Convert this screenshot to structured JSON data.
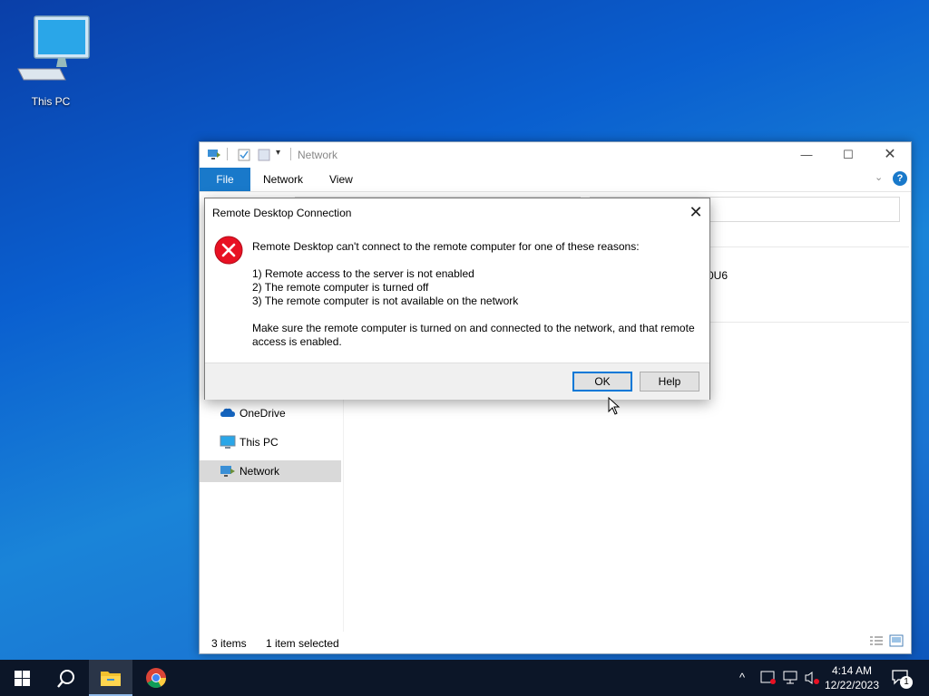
{
  "desktop": {
    "icons": [
      {
        "label": "This PC",
        "icon": "monitor-icon"
      }
    ]
  },
  "explorer": {
    "title": "Network",
    "ribbon_tabs": [
      "File",
      "Network",
      "View"
    ],
    "nav_items": [
      {
        "label": "OneDrive",
        "icon": "cloud-icon"
      },
      {
        "label": "This PC",
        "icon": "monitor-icon"
      },
      {
        "label": "Network",
        "icon": "network-icon",
        "selected": true
      }
    ],
    "partial_text": "0U6",
    "status": {
      "items": "3 items",
      "selected": "1 item selected"
    }
  },
  "dialog": {
    "title": "Remote Desktop Connection",
    "message_intro": "Remote Desktop can't connect to the remote computer for one of these reasons:",
    "reasons": [
      "1) Remote access to the server is not enabled",
      "2) The remote computer is turned off",
      "3) The remote computer is not available on the network"
    ],
    "advice_line1": "Make sure the remote computer is turned on and connected to the network, and that remote",
    "advice_line2": "access is enabled.",
    "ok_label": "OK",
    "help_label": "Help"
  },
  "taskbar": {
    "time": "4:14 AM",
    "date": "12/22/2023",
    "notification_count": "1",
    "pinned": [
      "start-icon",
      "search-icon",
      "file-explorer-icon",
      "chrome-icon"
    ]
  },
  "colors": {
    "accent": "#1979ca",
    "error": "#e81123",
    "taskbar": "#0c1628"
  }
}
